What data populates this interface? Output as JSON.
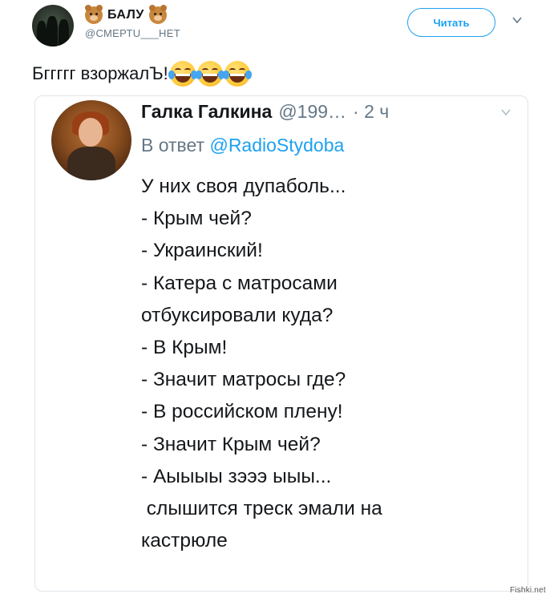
{
  "author": {
    "display_name": "БАЛУ",
    "handle": "@СМЕРТU___НЕТ",
    "avatar_icon": "profile-photo"
  },
  "follow_button": "Читать",
  "tweet_text": "Бггггг взоржалЪ!",
  "tweet_emojis": [
    "face-with-tears-of-joy-icon",
    "face-with-tears-of-joy-icon",
    "face-with-tears-of-joy-icon"
  ],
  "quoted": {
    "name": "Галка Галкина",
    "handle": "@199…",
    "time": "· 2 ч",
    "reply_prefix": "В ответ",
    "reply_mention": "@RadioStydoba",
    "lines": [
      "У них своя дупаболь...",
      "- Крым чей?",
      "- Украинский!",
      "- Катера с матросами",
      "отбуксировали куда?",
      "- В Крым!",
      "- Значит матросы где?",
      "- В российском плену!",
      "- Значит Крым чей?",
      "- Аыыыы зэээ ыыы...",
      " слышится треск эмали на",
      "кастрюле"
    ]
  },
  "watermark": "Fishki.net",
  "colors": {
    "accent": "#1da1f2",
    "muted": "#657786",
    "text": "#14171a",
    "border": "#dfe5ea"
  }
}
